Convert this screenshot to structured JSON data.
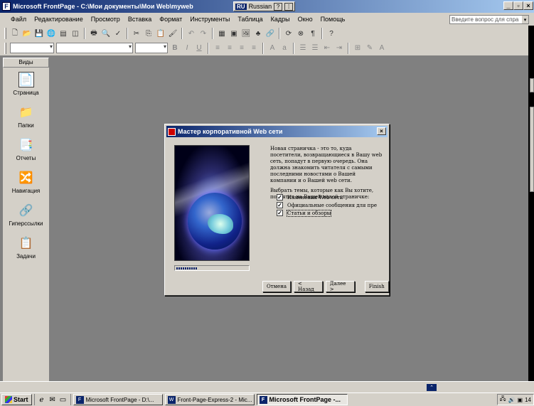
{
  "window": {
    "title": "Microsoft FrontPage - C:\\Мои документы\\Мои Web\\myweb",
    "language": {
      "code": "RU",
      "label": "Russian"
    },
    "buttons": {
      "minimize": "_",
      "maximize": "в",
      "close": "×"
    }
  },
  "menu": {
    "items": [
      "Файл",
      "Редактирование",
      "Просмотр",
      "Вставка",
      "Формат",
      "Инструменты",
      "Таблица",
      "Кадры",
      "Окно",
      "Помощь"
    ],
    "help_box_placeholder": "Введите вопрос для спра"
  },
  "toolbar": {
    "icons": [
      "new-page-icon",
      "open-icon",
      "save-icon",
      "publish-icon",
      "folder-list-icon",
      "print-icon",
      "preview-icon",
      "spelling-icon",
      "cut-icon",
      "copy-icon",
      "paste-icon",
      "undo-icon",
      "redo-icon",
      "table-icon",
      "picture-icon",
      "hyperlink-icon",
      "help-icon"
    ]
  },
  "format_toolbar": {
    "bold": "B",
    "italic": "I",
    "underline": "U"
  },
  "views": {
    "header": "Виды",
    "items": [
      {
        "label": "Страница",
        "icon": "page-view-icon",
        "glyph": "📄"
      },
      {
        "label": "Папки",
        "icon": "folders-view-icon",
        "glyph": "📁"
      },
      {
        "label": "Отчеты",
        "icon": "reports-view-icon",
        "glyph": "📑"
      },
      {
        "label": "Навигация",
        "icon": "navigation-view-icon",
        "glyph": "🔀"
      },
      {
        "label": "Гиперссылки",
        "icon": "hyperlinks-view-icon",
        "glyph": "🔗"
      },
      {
        "label": "Задачи",
        "icon": "tasks-view-icon",
        "glyph": "📋"
      }
    ]
  },
  "dialog": {
    "title": "Мастер корпоративной Web сети",
    "intro": "Новая страничка - это то, куда посетители, возвращающиеся в Вашу web сеть, попадут в первую очередь. Она должна знакомить читателя с самыми последними новостями о Вашей компании и о Вашей web сети.",
    "prompt": "Выбрать темы, которые как Вы хотите, появятся на Вашей новой страничке:",
    "checkboxes": [
      {
        "label": "Изменения Web сети",
        "checked": true
      },
      {
        "label": "Официальные сообщения для пре",
        "checked": true
      },
      {
        "label": "Статьи и обзоры",
        "checked": true
      }
    ],
    "progress": 0.3,
    "buttons": {
      "cancel": "Отмена",
      "back": "< Назад",
      "next": "Далее >",
      "finish": "Finish"
    }
  },
  "taskbar": {
    "start": "Start",
    "tasks": [
      {
        "label": "Microsoft FrontPage - D:\\...",
        "active": false
      },
      {
        "label": "Front-Page-Express-2 - Mic...",
        "active": false
      },
      {
        "label": "Microsoft FrontPage -...",
        "active": true
      }
    ],
    "clock": "14"
  }
}
